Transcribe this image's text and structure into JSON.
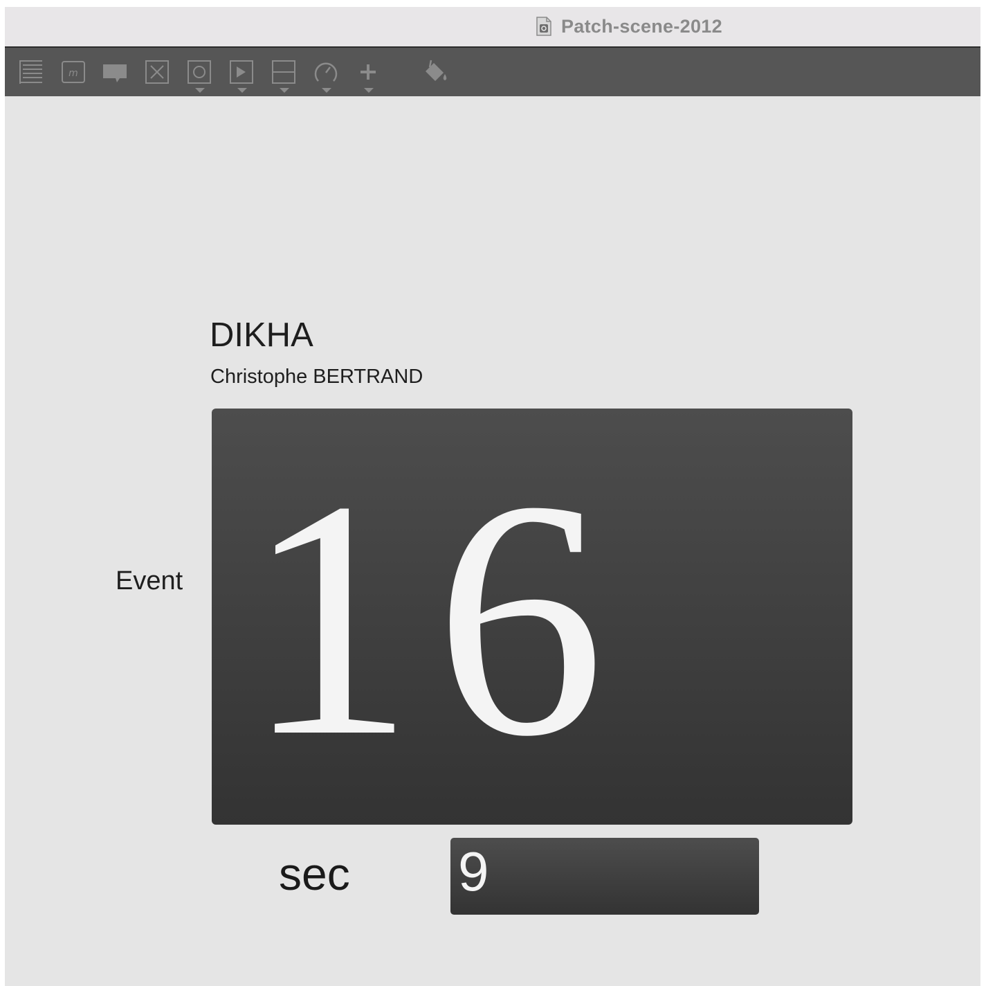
{
  "window": {
    "title": "Patch-scene-2012",
    "doc_icon": "locked-document-icon"
  },
  "toolbar": {
    "tools": [
      {
        "icon": "lines-icon",
        "has_menu": false
      },
      {
        "icon": "message-icon",
        "has_menu": false
      },
      {
        "icon": "comment-icon",
        "has_menu": false
      },
      {
        "icon": "close-box-icon",
        "has_menu": false
      },
      {
        "icon": "button-object-icon",
        "has_menu": true
      },
      {
        "icon": "play-icon",
        "has_menu": true
      },
      {
        "icon": "slider-icon",
        "has_menu": true
      },
      {
        "icon": "dial-icon",
        "has_menu": true
      },
      {
        "icon": "plus-icon",
        "has_menu": true
      },
      {
        "icon": "paint-bucket-icon",
        "has_menu": false
      }
    ],
    "icon_color": "#8b8b8b",
    "background": "#565656"
  },
  "patch": {
    "piece_title": "DIKHA",
    "composer": "Christophe BERTRAND",
    "event_label": "Event",
    "event_number": "16",
    "sec_label": "sec",
    "sec_value": "9"
  },
  "colors": {
    "canvas_bg": "#e5e5e5",
    "display_bg_top": "#4d4d4d",
    "display_bg_bottom": "#333333",
    "display_text": "#f4f4f4"
  }
}
